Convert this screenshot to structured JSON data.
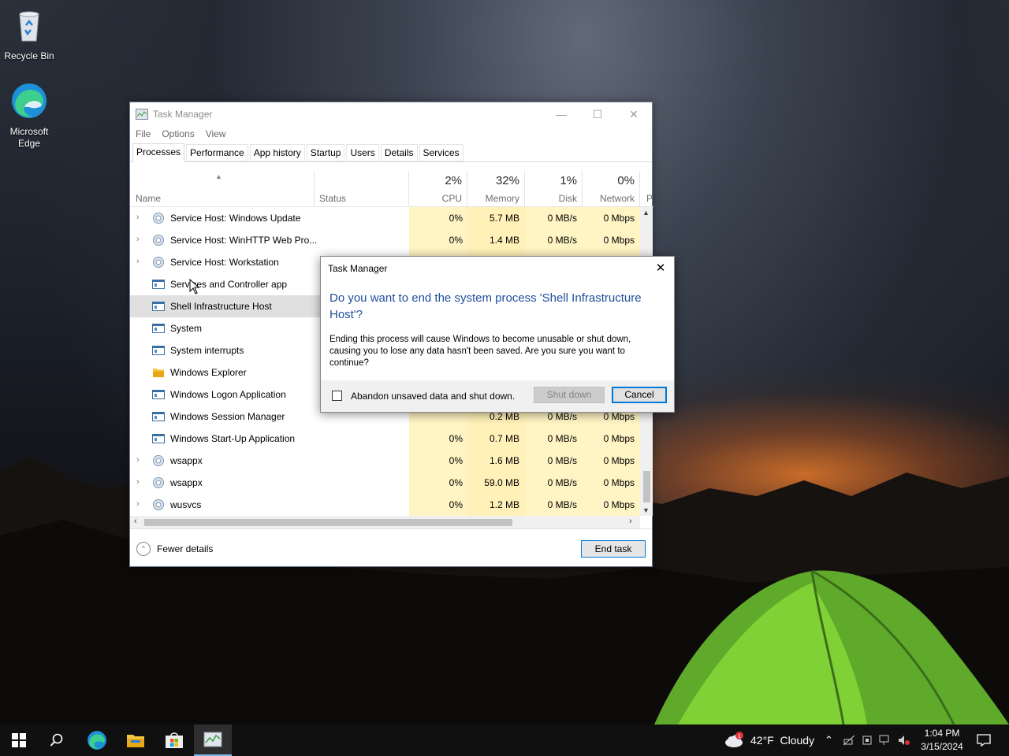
{
  "desktop": {
    "icons": [
      {
        "label": "Recycle Bin",
        "icon": "recycle-bin-icon"
      },
      {
        "label": "Microsoft Edge",
        "icon": "edge-icon"
      }
    ]
  },
  "task_manager": {
    "title": "Task Manager",
    "menu": [
      "File",
      "Options",
      "View"
    ],
    "tabs": [
      "Processes",
      "Performance",
      "App history",
      "Startup",
      "Users",
      "Details",
      "Services"
    ],
    "active_tab": "Processes",
    "columns": {
      "name": "Name",
      "status": "Status",
      "cpu": {
        "pct": "2%",
        "label": "CPU"
      },
      "memory": {
        "pct": "32%",
        "label": "Memory"
      },
      "disk": {
        "pct": "1%",
        "label": "Disk"
      },
      "network": {
        "pct": "0%",
        "label": "Network"
      },
      "power": "P"
    },
    "processes": [
      {
        "name": "Service Host: Windows Update",
        "expand": true,
        "icon": "gear-icon",
        "cpu": "0%",
        "memory": "5.7 MB",
        "disk": "0 MB/s",
        "network": "0 Mbps"
      },
      {
        "name": "Service Host: WinHTTP Web Pro...",
        "expand": true,
        "icon": "gear-icon",
        "cpu": "0%",
        "memory": "1.4 MB",
        "disk": "0 MB/s",
        "network": "0 Mbps"
      },
      {
        "name": "Service Host: Workstation",
        "expand": true,
        "icon": "gear-icon",
        "cpu": "",
        "memory": "",
        "disk": "",
        "network": ""
      },
      {
        "name": "Services and Controller app",
        "expand": false,
        "icon": "app-window-icon",
        "cpu": "",
        "memory": "",
        "disk": "",
        "network": ""
      },
      {
        "name": "Shell Infrastructure Host",
        "expand": false,
        "icon": "app-window-icon",
        "cpu": "",
        "memory": "",
        "disk": "",
        "network": "",
        "selected": true
      },
      {
        "name": "System",
        "expand": false,
        "icon": "app-window-icon",
        "cpu": "",
        "memory": "",
        "disk": "",
        "network": ""
      },
      {
        "name": "System interrupts",
        "expand": false,
        "icon": "app-window-icon",
        "cpu": "",
        "memory": "",
        "disk": "",
        "network": ""
      },
      {
        "name": "Windows Explorer",
        "expand": false,
        "icon": "folder-icon",
        "cpu": "",
        "memory": "",
        "disk": "",
        "network": ""
      },
      {
        "name": "Windows Logon Application",
        "expand": false,
        "icon": "app-window-icon",
        "cpu": "",
        "memory": "",
        "disk": "",
        "network": ""
      },
      {
        "name": "Windows Session Manager",
        "expand": false,
        "icon": "app-window-icon",
        "cpu": "",
        "memory": "0.2 MB",
        "disk": "0 MB/s",
        "network": "0 Mbps"
      },
      {
        "name": "Windows Start-Up Application",
        "expand": false,
        "icon": "app-window-icon",
        "cpu": "0%",
        "memory": "0.7 MB",
        "disk": "0 MB/s",
        "network": "0 Mbps"
      },
      {
        "name": "wsappx",
        "expand": true,
        "icon": "gear-icon",
        "cpu": "0%",
        "memory": "1.6 MB",
        "disk": "0 MB/s",
        "network": "0 Mbps"
      },
      {
        "name": "wsappx",
        "expand": true,
        "icon": "gear-icon",
        "cpu": "0%",
        "memory": "59.0 MB",
        "disk": "0 MB/s",
        "network": "0 Mbps"
      },
      {
        "name": "wusvcs",
        "expand": true,
        "icon": "gear-icon",
        "cpu": "0%",
        "memory": "1.2 MB",
        "disk": "0 MB/s",
        "network": "0 Mbps"
      }
    ],
    "fewer_details": "Fewer details",
    "end_task": "End task"
  },
  "dialog": {
    "title": "Task Manager",
    "heading": "Do you want to end the system process 'Shell Infrastructure Host'?",
    "body": "Ending this process will cause Windows to become unusable or shut down, causing you to lose any data hasn't been saved. Are you sure you want to continue?",
    "checkbox_label": "Abandon unsaved data and shut down.",
    "checkbox_checked": false,
    "shutdown_label": "Shut down",
    "cancel_label": "Cancel"
  },
  "taskbar": {
    "weather": "42°F  Cloudy",
    "weather_badge": "1",
    "time": "1:04 PM",
    "date": "3/15/2024"
  },
  "colors": {
    "accent": "#0078d7",
    "dialog_heading": "#1f4e9c",
    "cpu_cell": "#fff4c4"
  }
}
